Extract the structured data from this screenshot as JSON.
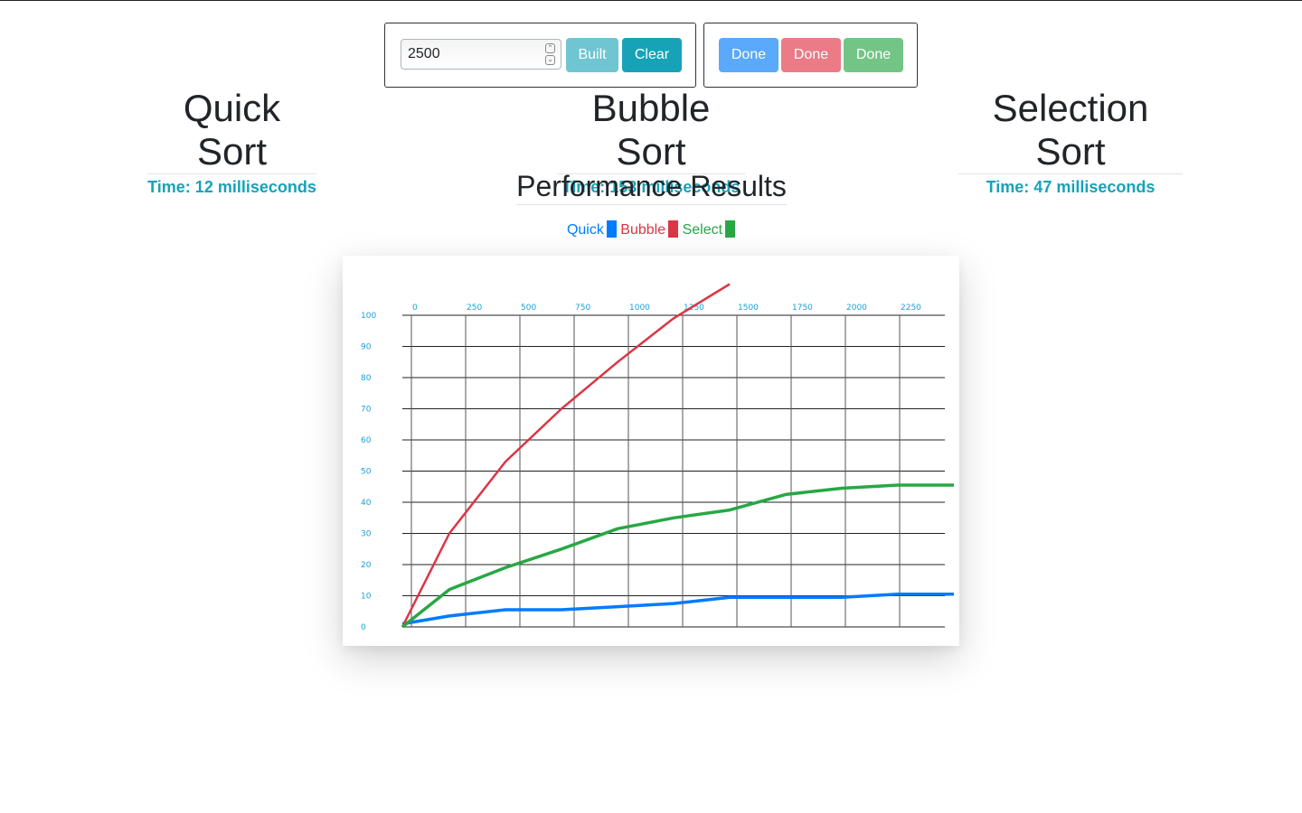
{
  "controls": {
    "size_input_value": "2500",
    "built_label": "Built",
    "clear_label": "Clear",
    "done_labels": [
      "Done",
      "Done",
      "Done"
    ]
  },
  "algorithms": {
    "quick": {
      "title": "Quick Sort",
      "time": "Time: 12 milliseconds"
    },
    "bubble": {
      "title": "Bubble Sort",
      "time": "Time: 153 milliseconds"
    },
    "selection": {
      "title": "Selection Sort",
      "time": "Time: 47 milliseconds"
    }
  },
  "results_title": "Performance Results",
  "legend": [
    {
      "label": "Quick",
      "color": "#007bff"
    },
    {
      "label": "Bubble",
      "color": "#dc3545"
    },
    {
      "label": "Select",
      "color": "#28a745"
    }
  ],
  "colors": {
    "info": "#17a2b8",
    "quick": "#007bff",
    "bubble": "#dc3545",
    "select": "#28a745"
  },
  "chart_data": {
    "type": "line",
    "title": "",
    "xlabel": "",
    "ylabel": "",
    "x_ticks": [
      0,
      250,
      500,
      750,
      1000,
      1250,
      1500,
      1750,
      2000,
      2250
    ],
    "y_ticks": [
      0,
      10,
      20,
      30,
      40,
      50,
      60,
      70,
      80,
      90,
      100
    ],
    "xlim": [
      0,
      2500
    ],
    "ylim": [
      0,
      100
    ],
    "grid": true,
    "series": [
      {
        "name": "Quick",
        "color": "#007bff",
        "x": [
          0,
          250,
          500,
          750,
          1000,
          1250,
          1500,
          1750,
          2000,
          2250,
          2500
        ],
        "y": [
          1,
          3.5,
          5.5,
          5.5,
          6.5,
          7.5,
          9.5,
          9.5,
          9.5,
          10.5,
          10.5
        ]
      },
      {
        "name": "Bubble",
        "color": "#dc3545",
        "x": [
          0,
          250,
          500,
          750,
          1000,
          1250,
          1500
        ],
        "y": [
          0,
          30,
          53,
          70,
          85,
          99,
          110
        ]
      },
      {
        "name": "Select",
        "color": "#28a745",
        "x": [
          0,
          250,
          500,
          750,
          1000,
          1250,
          1500,
          1750,
          2000,
          2250,
          2500
        ],
        "y": [
          0,
          12,
          19,
          25,
          31.5,
          35,
          37.5,
          42.5,
          44.5,
          45.5,
          45.5
        ]
      }
    ]
  }
}
